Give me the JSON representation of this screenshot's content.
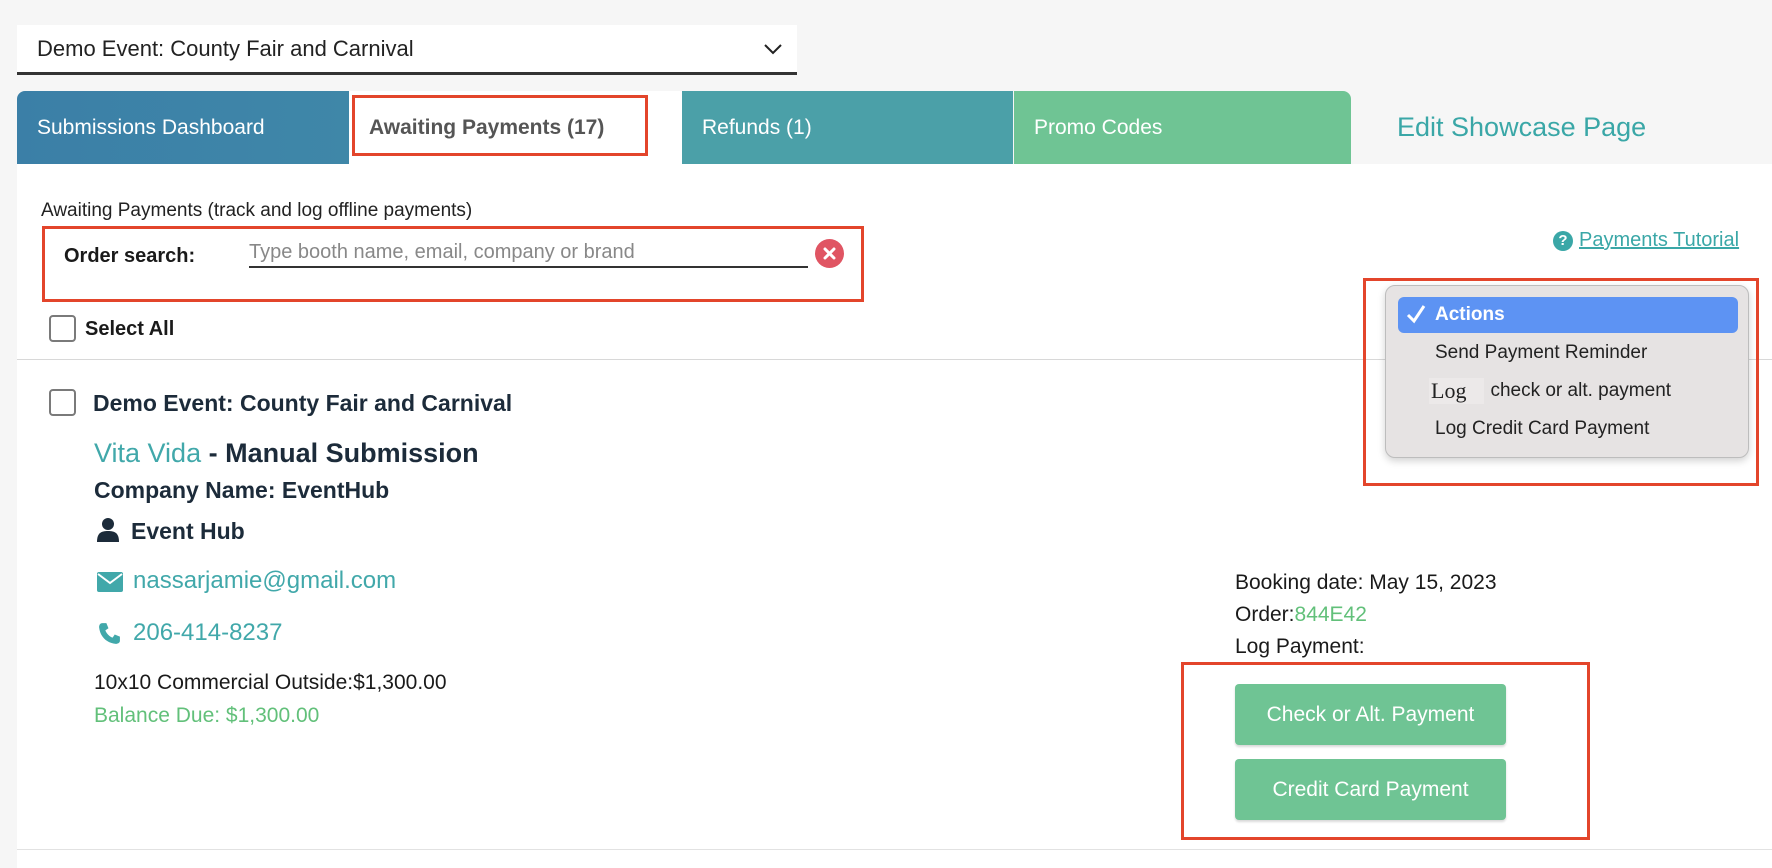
{
  "event_select": {
    "value": "Demo Event: County Fair and Carnival"
  },
  "tabs": {
    "dashboard": "Submissions Dashboard",
    "awaiting": "Awaiting Payments (17)",
    "refunds": "Refunds (1)",
    "promo": "Promo Codes",
    "edit_showcase": "Edit Showcase Page"
  },
  "section": {
    "subtitle": "Awaiting Payments (track and log offline payments)",
    "search_label": "Order search:",
    "search_placeholder": "Type booth name, email, company or brand",
    "search_value": "",
    "tutorial": "Payments Tutorial",
    "select_all": "Select All"
  },
  "actions_menu": {
    "items": [
      "Actions",
      "Send Payment Reminder",
      "Log",
      "check or alt. payment",
      "Log Credit Card Payment"
    ]
  },
  "order": {
    "event": "Demo Event: County Fair and Carnival",
    "booth_name": "Vita Vida",
    "submission_type": " - Manual Submission",
    "company": "Company Name: EventHub",
    "contact": "Event Hub",
    "email": "nassarjamie@gmail.com",
    "phone": "206-414-8237",
    "item": "10x10 Commercial Outside:$1,300.00",
    "balance": "Balance Due: $1,300.00",
    "booking_date": "Booking date: May 15, 2023",
    "order_label": "Order:",
    "order_code": "844E42",
    "log_payment": "Log Payment:",
    "btn_check": "Check or Alt. Payment",
    "btn_cc": "Credit Card Payment"
  },
  "colors": {
    "accent_teal": "#41a8aa",
    "green": "#6fc494",
    "menu_highlight": "#5d93f3",
    "annotation_red": "#e3452b"
  }
}
